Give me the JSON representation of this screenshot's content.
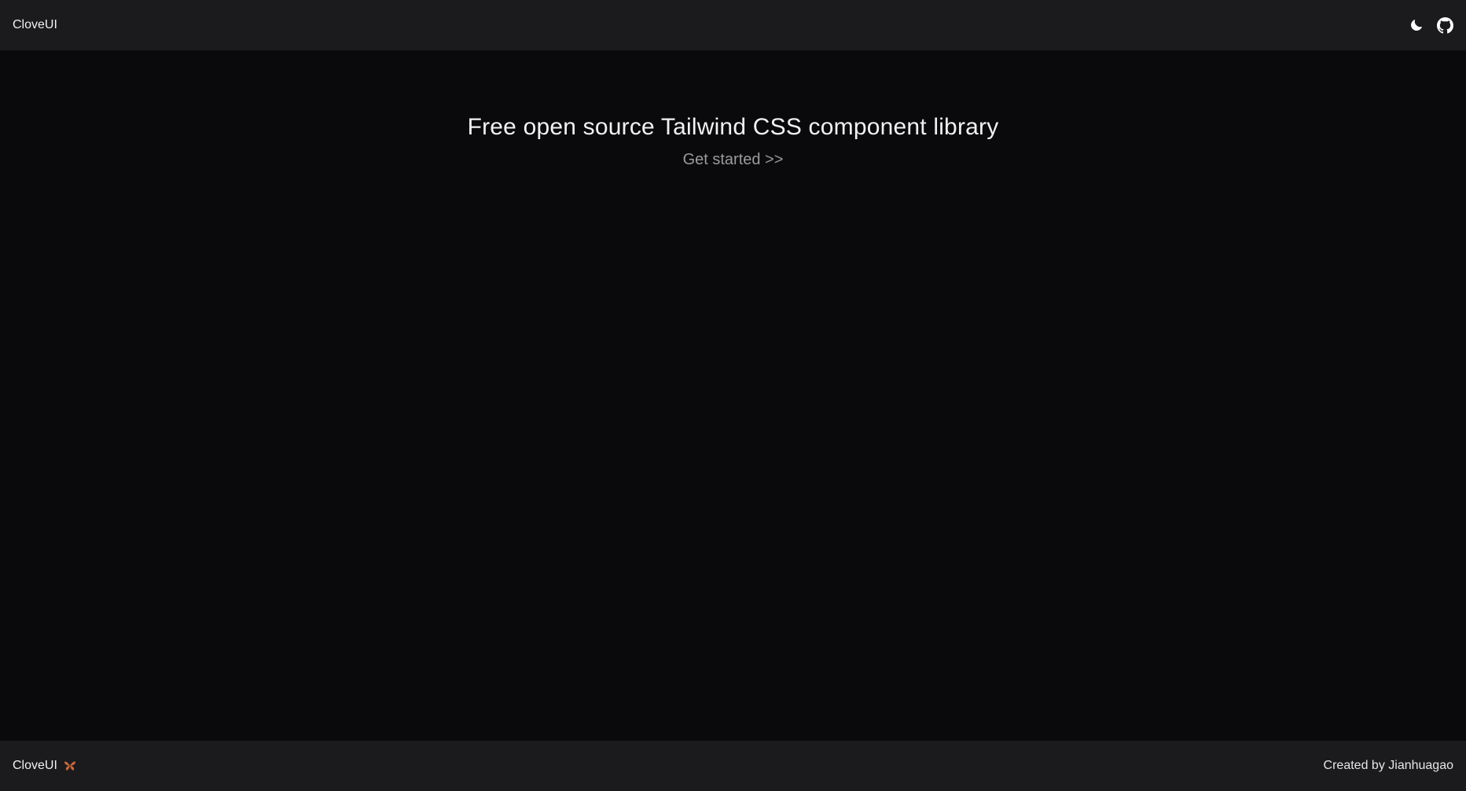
{
  "header": {
    "brand": "CloveUI",
    "icons": [
      "moon-icon",
      "github-icon"
    ]
  },
  "hero": {
    "title": "Free open source Tailwind CSS component library",
    "cta": "Get started >>"
  },
  "footer": {
    "brand": "CloveUI",
    "brand_icon": "butterfly-icon",
    "credit": "Created by Jianhuagao"
  },
  "colors": {
    "bar_background": "#1b1b1e",
    "page_background": "#0a0a0c",
    "butterfly_accent": "#c8683a"
  }
}
